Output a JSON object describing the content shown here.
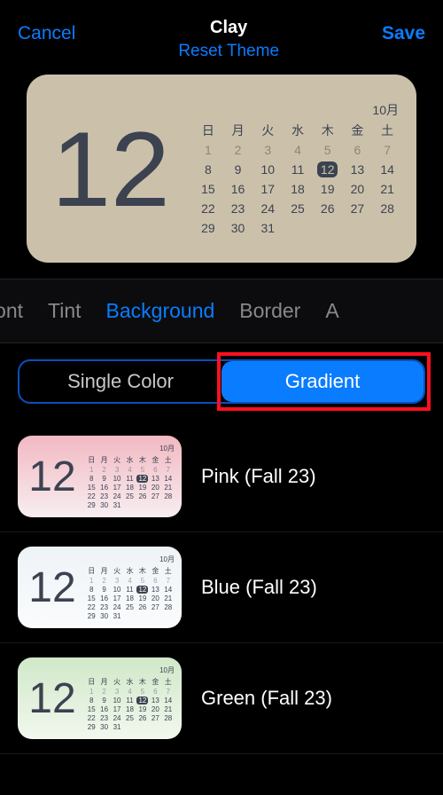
{
  "header": {
    "cancel": "Cancel",
    "title": "Clay",
    "reset": "Reset Theme",
    "save": "Save"
  },
  "preview": {
    "big_day": "12",
    "month_label": "10月",
    "weekdays": [
      "日",
      "月",
      "火",
      "水",
      "木",
      "金",
      "土"
    ],
    "today": 12,
    "rows": [
      [
        1,
        2,
        3,
        4,
        5,
        6,
        7
      ],
      [
        8,
        9,
        10,
        11,
        12,
        13,
        14
      ],
      [
        15,
        16,
        17,
        18,
        19,
        20,
        21
      ],
      [
        22,
        23,
        24,
        25,
        26,
        27,
        28
      ],
      [
        29,
        30,
        31
      ]
    ],
    "dim_first_row": true
  },
  "tabs": {
    "items": [
      "Font",
      "Tint",
      "Background",
      "Border",
      "A"
    ],
    "active_index": 2
  },
  "segment": {
    "left": "Single Color",
    "right": "Gradient",
    "active": "right"
  },
  "options": [
    {
      "label": "Pink (Fall 23)",
      "bg_class": "bg-pink"
    },
    {
      "label": "Blue (Fall 23)",
      "bg_class": "bg-blue"
    },
    {
      "label": "Green (Fall 23)",
      "bg_class": "bg-green"
    }
  ]
}
